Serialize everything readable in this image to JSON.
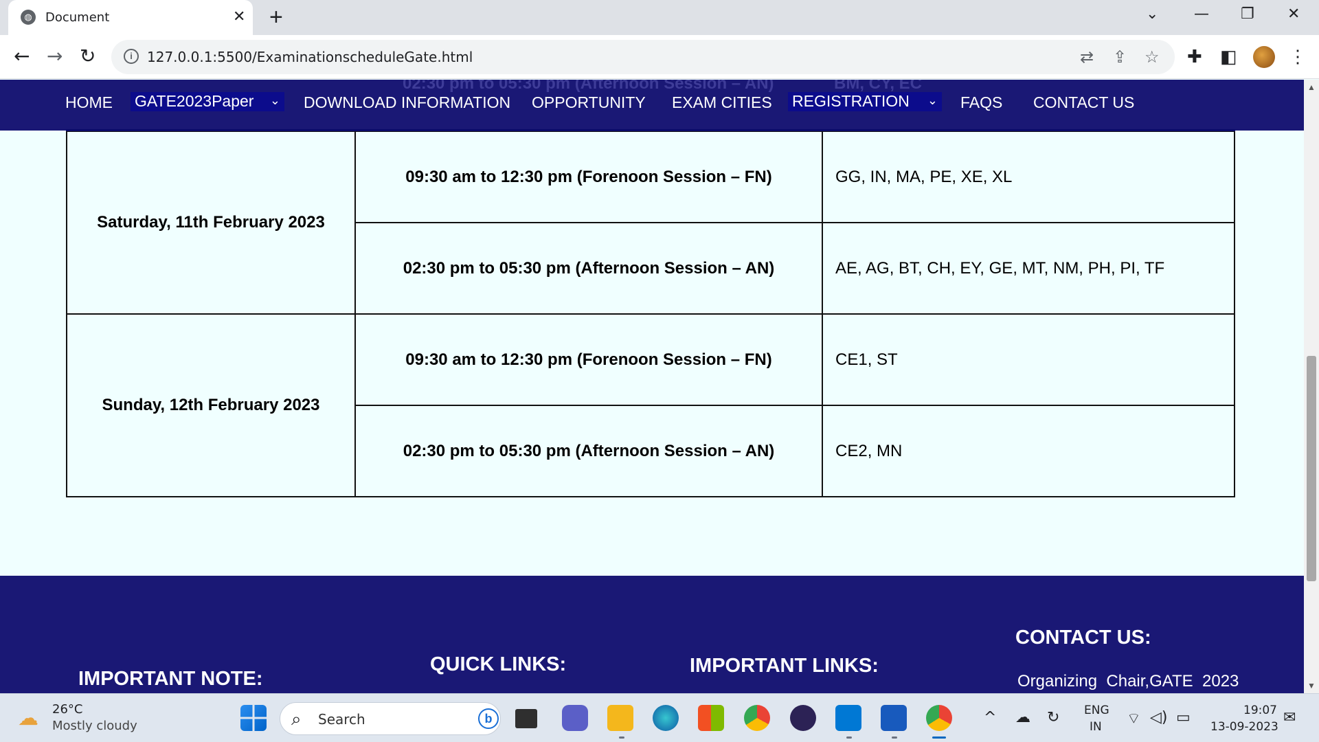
{
  "browser": {
    "tab_title": "Document",
    "url": "127.0.0.1:5500/ExaminationscheduleGate.html"
  },
  "navbar": {
    "ghost_time": "02:30 pm to 05:30 pm (Afternoon Session – AN)",
    "ghost_papers": "BM, CY, EC",
    "items": {
      "home": "HOME",
      "paper": "GATE2023Paper",
      "download": "DOWNLOAD INFORMATION",
      "opportunity": "OPPORTUNITY",
      "cities": "EXAM CITIES",
      "registration": "REGISTRATION",
      "faqs": "FAQS",
      "contact": "CONTACT US"
    }
  },
  "schedule": [
    {
      "day": "Saturday, 11th February 2023",
      "sessions": [
        {
          "time": "09:30 am to 12:30 pm (Forenoon Session – FN)",
          "papers": "GG, IN, MA, PE, XE, XL"
        },
        {
          "time": "02:30 pm to 05:30 pm (Afternoon Session – AN)",
          "papers": "AE, AG, BT, CH, EY, GE, MT, NM, PH, PI, TF"
        }
      ]
    },
    {
      "day": "Sunday, 12th February 2023",
      "sessions": [
        {
          "time": "09:30 am to 12:30 pm (Forenoon Session – FN)",
          "papers": "CE1, ST"
        },
        {
          "time": "02:30 pm to 05:30 pm (Afternoon Session – AN)",
          "papers": "CE2, MN"
        }
      ]
    }
  ],
  "footer": {
    "important_note": "IMPORTANT NOTE:",
    "quick_links": "QUICK LINKS:",
    "important_links": "IMPORTANT LINKS:",
    "contact_us": "CONTACT US:",
    "contact_line": "Organizing  Chair,GATE  2023"
  },
  "taskbar": {
    "temperature": "26°C",
    "weather": "Mostly cloudy",
    "search_placeholder": "Search",
    "lang_top": "ENG",
    "lang_bottom": "IN",
    "time": "19:07",
    "date": "13-09-2023"
  }
}
